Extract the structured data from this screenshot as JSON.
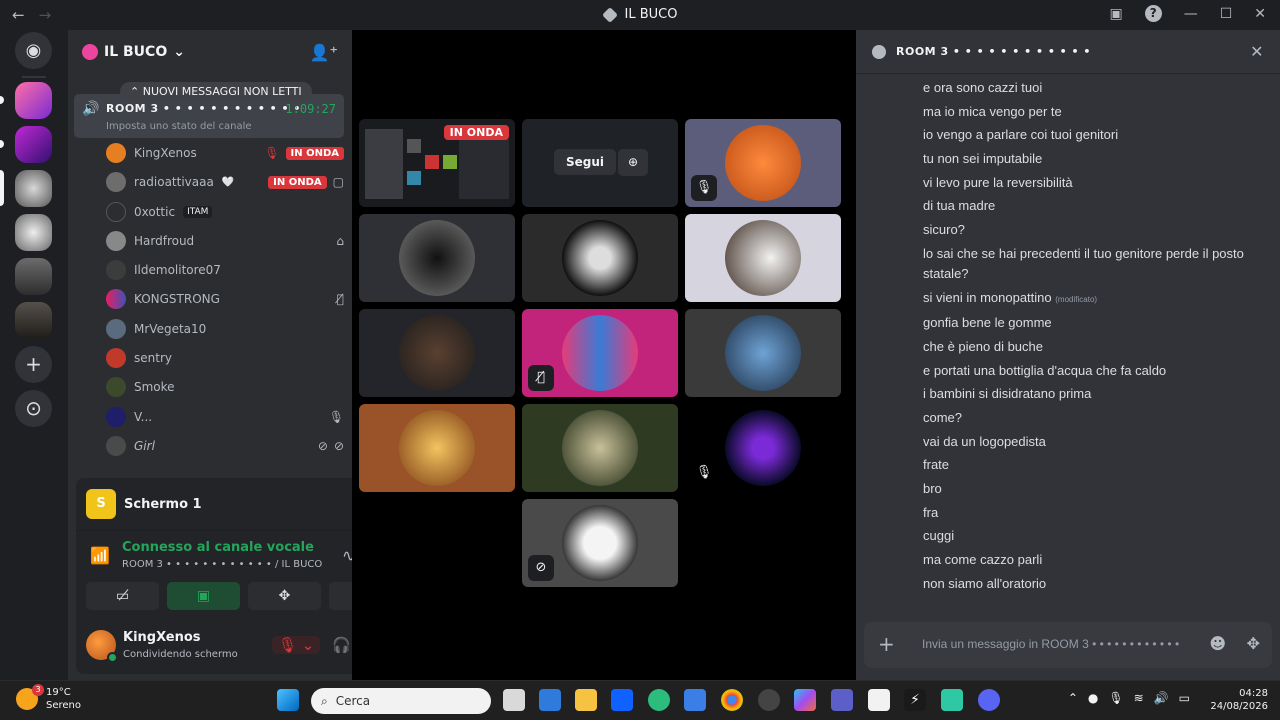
{
  "window": {
    "title": "IL BUCO"
  },
  "server": {
    "name": "IL BUCO",
    "new_messages": "NUOVI MESSAGGI NON LETTI",
    "room": {
      "name": "ROOM 3 • • • • • • • • • • • •",
      "time": "1:09:27",
      "status": "Imposta uno stato del canale"
    },
    "members": [
      {
        "name": "KingXenos",
        "badge": "IN ONDA",
        "color": "#e67e22"
      },
      {
        "name": "radioattivaaa",
        "badge": "IN ONDA",
        "color": "#6d6d6d"
      },
      {
        "name": "0xottic",
        "tag": "ITAM",
        "color": "#2b2d31"
      },
      {
        "name": "Hardfroud",
        "color": "#888888"
      },
      {
        "name": "Ildemolitore07",
        "color": "#3c3c3c"
      },
      {
        "name": "KONGSTRONG",
        "color": "#9b59b6"
      },
      {
        "name": "MrVegeta10",
        "color": "#5a6b7d"
      },
      {
        "name": "sentry",
        "color": "#c0392b"
      },
      {
        "name": "Smoke",
        "color": "#3b4a2b"
      },
      {
        "name": "V...",
        "color": "#1e1e6a"
      },
      {
        "name": "Girl",
        "color": "#4a4a4a"
      }
    ]
  },
  "panel": {
    "screen_label": "Schermo 1",
    "screen_letter": "S",
    "connected": "Connesso al canale vocale",
    "location": "ROOM 3 • • • • • • • • • • • • / IL BUCO",
    "user": {
      "name": "KingXenos",
      "status": "Condividendo schermo"
    }
  },
  "stage": {
    "live_badge": "IN ONDA",
    "follow_button": "Segui"
  },
  "chat": {
    "title": "ROOM 3 • • • • • • • • • • • •",
    "messages": [
      "e ora sono cazzi tuoi",
      "ma io mica vengo per te",
      "io vengo a parlare coi tuoi genitori",
      "tu non sei imputabile",
      "vi levo pure la reversibilità",
      "di tua madre",
      "sicuro?",
      "lo sai che se hai precedenti il tuo genitore perde il posto statale?",
      "si vieni in monopattino",
      "gonfia bene le gomme",
      "che  è pieno di buche",
      "e portati una bottiglia d'acqua che fa caldo",
      "i bambini si disidratano prima",
      "come?",
      "vai da un logopedista",
      "frate",
      "bro",
      "fra",
      "cuggi",
      "ma come cazzo parli",
      "non siamo all'oratorio"
    ],
    "edited_label": "(modificato)",
    "placeholder": "Invia un messaggio in ROOM 3 • • • • • • • • • • • •"
  },
  "taskbar": {
    "temp": "19°C",
    "weather": "Sereno",
    "weather_badge": "3",
    "search": "Cerca",
    "time": "04:28",
    "date": "24/08/2026"
  }
}
